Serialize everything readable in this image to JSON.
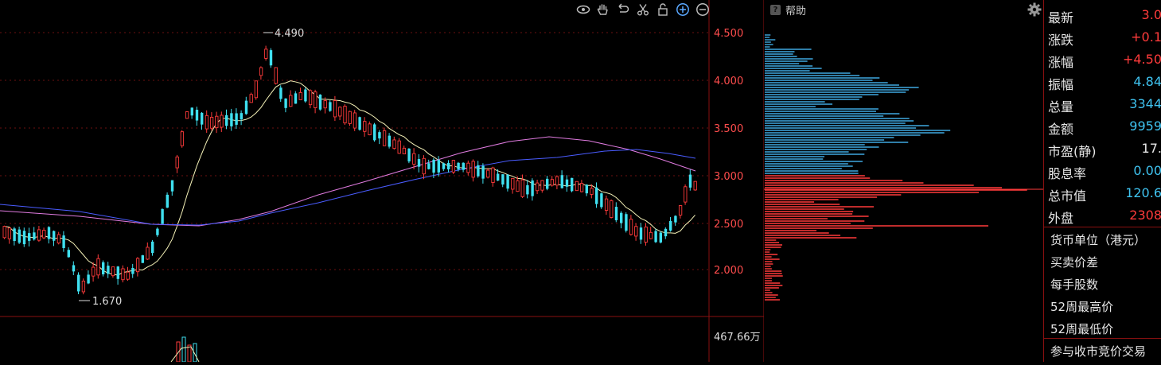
{
  "chart": {
    "price_ticks": [
      "4.500",
      "4.000",
      "3.500",
      "3.000",
      "2.500",
      "2.000"
    ],
    "high_label": "4.490",
    "low_label": "1.670",
    "volume_label": "467.66万"
  },
  "toolbar": {
    "icons": [
      "eye-icon",
      "hand-icon",
      "undo-icon",
      "scissors-icon",
      "lock-icon",
      "zoom-in-icon",
      "zoom-out-icon"
    ]
  },
  "profile": {
    "help_label": "帮助",
    "help_icon_text": "?"
  },
  "quote": {
    "rows": [
      {
        "label": "最新",
        "value": "3.0",
        "color": "#ff3b3b"
      },
      {
        "label": "涨跌",
        "value": "+0.1",
        "color": "#ff3b3b"
      },
      {
        "label": "涨幅",
        "value": "+4.50",
        "color": "#ff3b3b"
      },
      {
        "label": "振幅",
        "value": "4.84",
        "color": "#3fc3f0"
      },
      {
        "label": "总量",
        "value": "3344",
        "color": "#3fc3f0"
      },
      {
        "label": "金额",
        "value": "9959",
        "color": "#3fc3f0"
      },
      {
        "label": "市盈(静)",
        "value": "17.",
        "color": "#e6e6e6"
      },
      {
        "label": "股息率",
        "value": "0.00",
        "color": "#3fc3f0"
      },
      {
        "label": "总市值",
        "value": "120.6",
        "color": "#3fc3f0"
      },
      {
        "label": "外盘",
        "value": "2308",
        "color": "#ff3b3b"
      }
    ],
    "info_rows": [
      "货币单位（港元）",
      "买卖价差",
      "每手股数",
      "52周最高价",
      "52周最低价",
      "参与收市竞价交易"
    ]
  },
  "colors": {
    "up": "#ff3b3b",
    "down": "#3fe0f0",
    "grid": "#6b0f0f",
    "ma_short": "#f5f2b8",
    "ma_mid": "#e07be0",
    "ma_long": "#4a5cff"
  }
}
